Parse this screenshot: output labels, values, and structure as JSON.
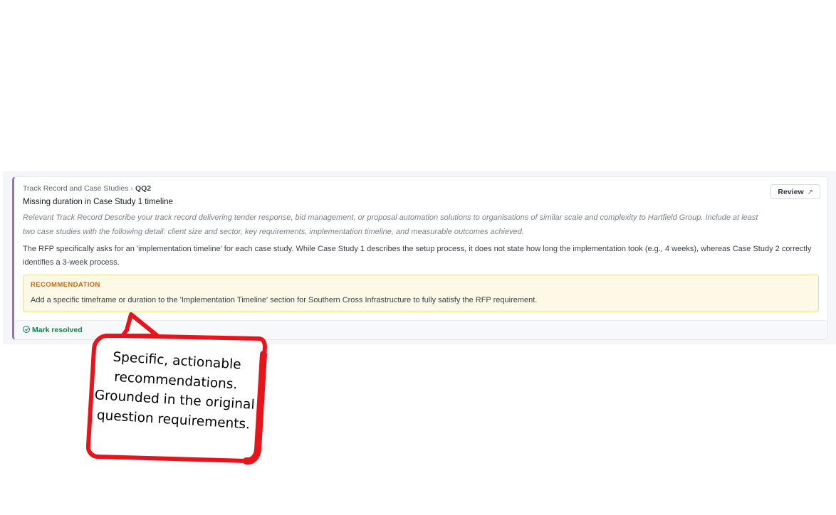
{
  "finding_card": {
    "breadcrumb": {
      "section": "Track Record and Case Studies",
      "separator": "›",
      "question_code": "QQ2"
    },
    "title": "Missing duration in Case Study 1 timeline",
    "question_text": "Relevant Track Record Describe your track record delivering tender response, bid management, or proposal automation solutions to organisations of similar scale and complexity to Hartfield Group. Include at least two case studies with the following detail: client size and sector, key requirements, implementation timeline, and measurable outcomes achieved.",
    "finding_text": "The RFP specifically asks for an 'implementation timeline' for each case study. While Case Study 1 describes the setup process, it does not state how long the implementation took (e.g., 4 weeks), whereas Case Study 2 correctly identifies a 3-week process.",
    "recommendation": {
      "label": "RECOMMENDATION",
      "text": "Add a specific timeframe or duration to the 'Implementation Timeline' section for Southern Cross Infrastructure to fully satisfy the RFP requirement."
    },
    "review_button": {
      "label": "Review",
      "icon": "arrow-up-right-icon"
    },
    "resolve_button": {
      "label": "Mark resolved",
      "icon": "check-circle-icon"
    }
  },
  "callout": {
    "text": "Specific, actionable recommendations. Grounded in the original question requirements."
  },
  "colors": {
    "accent_border": "#9b6bd3",
    "recommendation_bg": "#fdf9e7",
    "recommendation_label": "#c46a14",
    "resolve_green": "#1c7a4a",
    "callout_red": "#e8141b"
  }
}
